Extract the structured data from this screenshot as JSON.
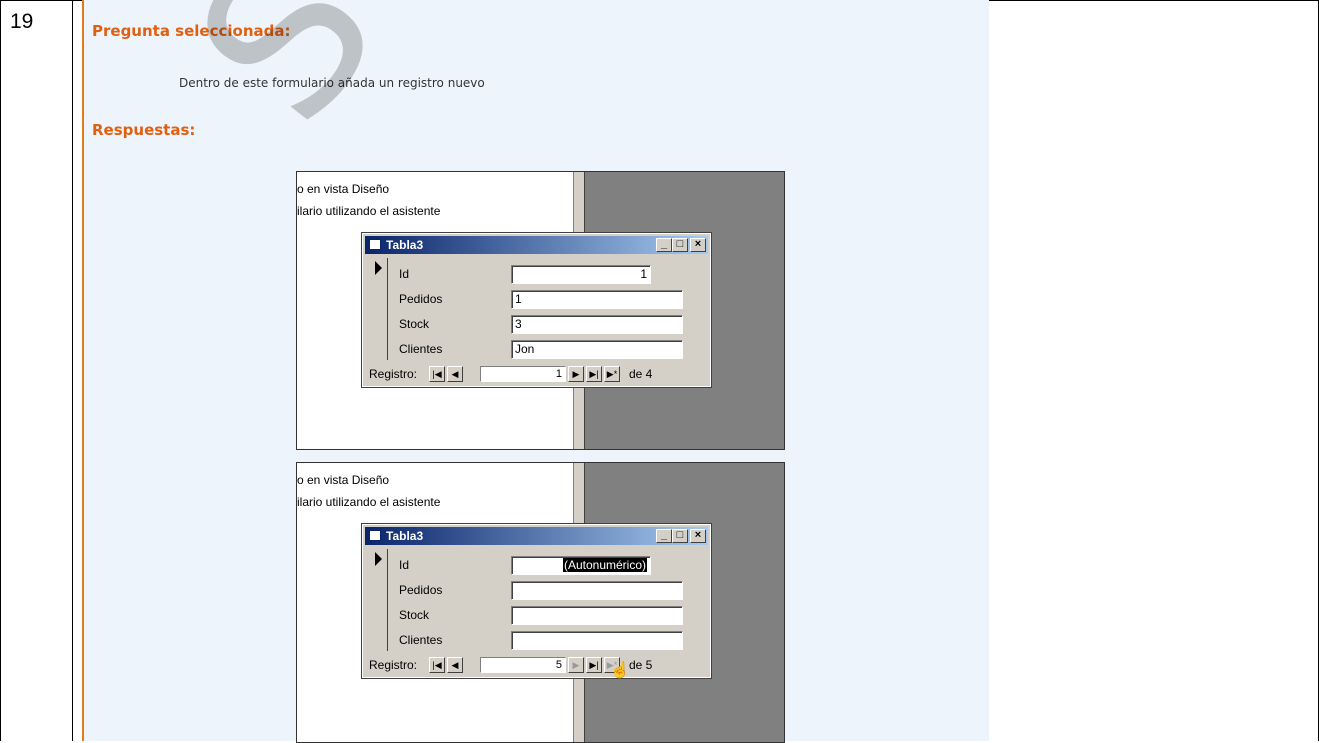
{
  "question_number": "19",
  "heading_selected": "Pregunta seleccionada:",
  "question_text": "Dentro de este formulario añada un registro nuevo",
  "heading_answers": "Respuestas:",
  "watermark": "SOSIT",
  "screens": [
    {
      "menu_line_1": "o en vista Diseño",
      "menu_line_2": "ilario utilizando el asistente",
      "window_title": "Tabla3",
      "fields": [
        {
          "label": "Id",
          "value": "1"
        },
        {
          "label": "Pedidos",
          "value": "1"
        },
        {
          "label": "Stock",
          "value": "3"
        },
        {
          "label": "Clientes",
          "value": "Jon"
        }
      ],
      "nav_label": "Registro:",
      "record_number": "1",
      "record_total": "de 4"
    },
    {
      "menu_line_1": "o en vista Diseño",
      "menu_line_2": "ilario utilizando el asistente",
      "window_title": "Tabla3",
      "fields": [
        {
          "label": "Id",
          "value": "(Autonumérico)"
        },
        {
          "label": "Pedidos",
          "value": ""
        },
        {
          "label": "Stock",
          "value": ""
        },
        {
          "label": "Clientes",
          "value": ""
        }
      ],
      "nav_label": "Registro:",
      "record_number": "5",
      "record_total": "de 5"
    }
  ],
  "colors": {
    "heading": "#e06010",
    "panel": "#eef4fb",
    "titlebar": "#0a246a"
  },
  "icons": [
    "form-icon",
    "minimize-icon",
    "maximize-icon",
    "close-icon",
    "record-selector-icon",
    "first-record-icon",
    "prev-record-icon",
    "next-record-icon",
    "last-record-icon",
    "new-record-icon",
    "hand-cursor-icon"
  ]
}
